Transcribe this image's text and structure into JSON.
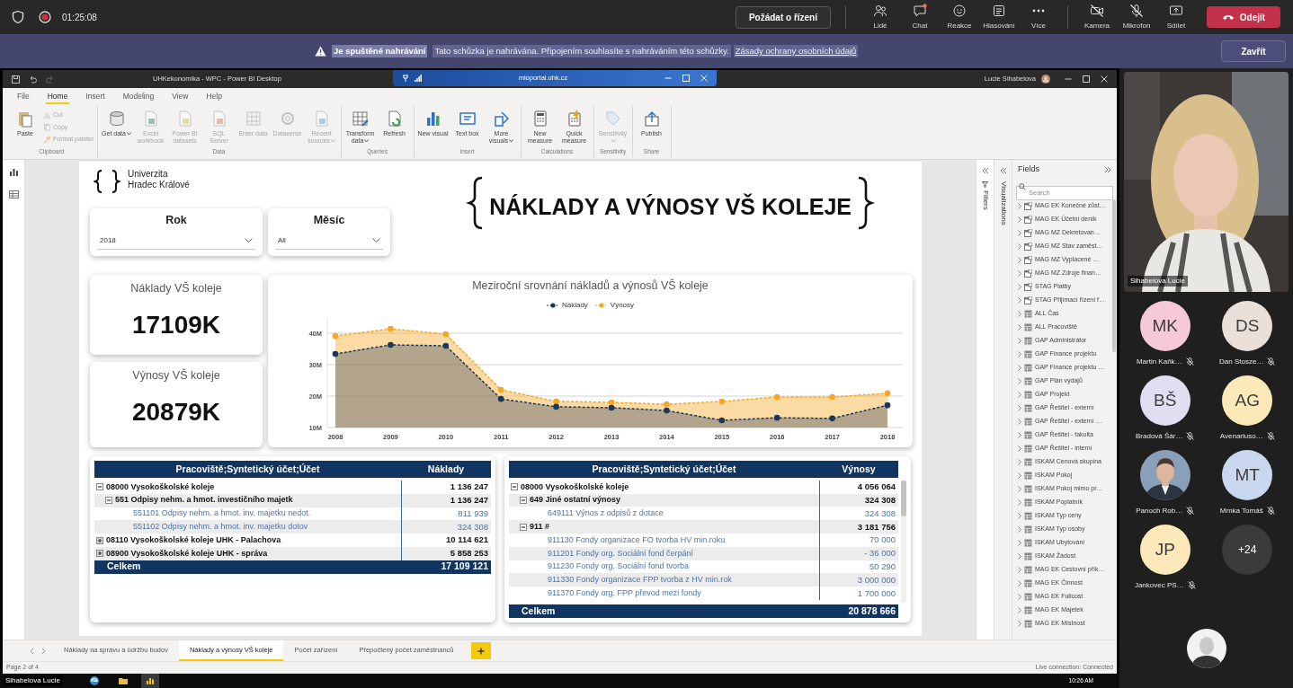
{
  "meeting_bar": {
    "timer": "01:25:08",
    "request_control": "Požádat o řízení",
    "tools": [
      {
        "kind": "people",
        "label": "Lidé",
        "badge": false
      },
      {
        "kind": "chat",
        "label": "Chat",
        "badge": true
      },
      {
        "kind": "reactions",
        "label": "Reakce",
        "badge": false
      },
      {
        "kind": "poll",
        "label": "Hlasování",
        "badge": false
      },
      {
        "kind": "more",
        "label": "Více",
        "badge": false
      }
    ],
    "devices": [
      {
        "kind": "camera",
        "label": "Kamera",
        "off": true
      },
      {
        "kind": "microphone",
        "label": "Mikrofon",
        "off": true
      },
      {
        "kind": "share",
        "label": "Sdílet",
        "off": false
      }
    ],
    "leave": "Odejít"
  },
  "recording_banner": {
    "title": "Je spuštěné nahrávání",
    "message": "Tato schůzka je nahrávána. Připojením souhlasíte s nahráváním této schůzky.",
    "link": "Zásady ochrany osobních údajů",
    "close": "Zavřít"
  },
  "window": {
    "title": "UHKekonomika - WPC - Power BI Desktop",
    "remote_host": "mioportal.uhk.cz",
    "user": "Lucie Sihabelova"
  },
  "ribbon": {
    "tabs": [
      {
        "label": "File",
        "selected": false
      },
      {
        "label": "Home",
        "selected": true
      },
      {
        "label": "Insert",
        "selected": false
      },
      {
        "label": "Modeling",
        "selected": false
      },
      {
        "label": "View",
        "selected": false
      },
      {
        "label": "Help",
        "selected": false
      }
    ],
    "groups": [
      {
        "name": "Clipboard",
        "buttons": [
          {
            "kind": "paste",
            "label": "Paste",
            "disabled": false,
            "dropdown": false
          }
        ],
        "small_buttons": [
          {
            "kind": "cut",
            "label": "Cut",
            "disabled": true,
            "dropdown": false
          },
          {
            "kind": "copy",
            "label": "Copy",
            "disabled": true,
            "dropdown": false
          },
          {
            "kind": "format_painter",
            "label": "Format painter",
            "disabled": true,
            "dropdown": false
          }
        ]
      },
      {
        "name": "Data",
        "buttons": [
          {
            "kind": "get_data",
            "label": "Get data",
            "disabled": false,
            "dropdown": true
          },
          {
            "kind": "excel",
            "label": "Excel workbook",
            "disabled": true,
            "dropdown": false
          },
          {
            "kind": "datasets",
            "label": "Power BI datasets",
            "disabled": true,
            "dropdown": false
          },
          {
            "kind": "sql",
            "label": "SQL Server",
            "disabled": true,
            "dropdown": false
          },
          {
            "kind": "enter_data",
            "label": "Enter data",
            "disabled": true,
            "dropdown": false
          },
          {
            "kind": "dataverse",
            "label": "Dataverse",
            "disabled": true,
            "dropdown": false
          },
          {
            "kind": "recent",
            "label": "Recent sources",
            "disabled": true,
            "dropdown": true
          }
        ]
      },
      {
        "name": "Queries",
        "buttons": [
          {
            "kind": "transform",
            "label": "Transform data",
            "disabled": false,
            "dropdown": true
          },
          {
            "kind": "refresh",
            "label": "Refresh",
            "disabled": false,
            "dropdown": false
          }
        ]
      },
      {
        "name": "Insert",
        "buttons": [
          {
            "kind": "new_visual",
            "label": "New visual",
            "disabled": false,
            "dropdown": false
          },
          {
            "kind": "text_box",
            "label": "Text box",
            "disabled": false,
            "dropdown": false
          },
          {
            "kind": "more_visuals",
            "label": "More visuals",
            "disabled": false,
            "dropdown": true
          }
        ]
      },
      {
        "name": "Calculations",
        "buttons": [
          {
            "kind": "new_measure",
            "label": "New measure",
            "disabled": false,
            "dropdown": false
          },
          {
            "kind": "quick_measure",
            "label": "Quick measure",
            "disabled": false,
            "dropdown": false
          }
        ]
      },
      {
        "name": "Sensitivity",
        "buttons": [
          {
            "kind": "sensitivity",
            "label": "Sensitivity",
            "disabled": true,
            "dropdown": true
          }
        ]
      },
      {
        "name": "Share",
        "buttons": [
          {
            "kind": "publish",
            "label": "Publish",
            "disabled": false,
            "dropdown": false
          }
        ]
      }
    ]
  },
  "report": {
    "logo_text": "Univerzita Hradec Králové",
    "title": "NÁKLADY A VÝNOSY VŠ KOLEJE",
    "slicers": [
      {
        "title": "Rok",
        "value": "2018"
      },
      {
        "title": "Měsíc",
        "value": "All"
      }
    ],
    "cards": [
      {
        "label": "Náklady VŠ koleje",
        "value": "17109K"
      },
      {
        "label": "Výnosy VŠ koleje",
        "value": "20879K"
      }
    ],
    "chart": {
      "chart_data": {
        "type": "area",
        "title": "Meziroční srovnání nákladů a výnosů VŠ koleje",
        "categories": [
          "2008",
          "2009",
          "2010",
          "2011",
          "2012",
          "2013",
          "2014",
          "2015",
          "2016",
          "2017",
          "2018"
        ],
        "series": [
          {
            "name": "Náklady",
            "color": "#1b365d",
            "values": [
              33.4,
              36.3,
              36.0,
              19.1,
              16.6,
              16.3,
              15.4,
              12.3,
              13.1,
              12.9,
              17.1
            ]
          },
          {
            "name": "Výnosy",
            "color": "#f5a623",
            "values": [
              39.1,
              41.4,
              39.7,
              22.0,
              18.3,
              18.0,
              17.4,
              18.3,
              19.7,
              19.7,
              20.9
            ]
          }
        ],
        "yticks": [
          {
            "value": 10,
            "label": "10M"
          },
          {
            "value": 20,
            "label": "20M"
          },
          {
            "value": 30,
            "label": "30M"
          },
          {
            "value": 40,
            "label": "40M"
          }
        ],
        "ylim": [
          10,
          45
        ],
        "grid": true,
        "legend": true
      }
    },
    "tables": [
      {
        "columns": [
          "Pracoviště;Syntetický účet;Účet",
          "Náklady"
        ],
        "rows": [
          {
            "label": "08000 Vysokoškolské koleje",
            "value": "1 136 247",
            "expanded": true,
            "children": [
              {
                "label": "551 Odpisy nehm. a hmot. investičního majetk",
                "value": "1 136 247",
                "expanded": true,
                "children": [
                  {
                    "label": "551101 Odpisy nehm. a hmot. inv. majetku nedot.",
                    "value": "811 939"
                  },
                  {
                    "label": "551102 Odpisy nehm. a hmot. inv. majetku dotov",
                    "value": "324 308"
                  }
                ]
              }
            ]
          },
          {
            "label": "08110 Vysokoškolské koleje UHK - Palachova",
            "value": "10 114 621",
            "expanded": false
          },
          {
            "label": "08900 Vysokoškolské koleje UHK - správa",
            "value": "5 858 253",
            "expanded": false
          }
        ],
        "total": {
          "label": "Celkem",
          "value": "17 109 121"
        }
      },
      {
        "columns": [
          "Pracoviště;Syntetický účet;Účet",
          "Výnosy"
        ],
        "rows": [
          {
            "label": "08000 Vysokoškolské koleje",
            "value": "4 056 064",
            "expanded": true,
            "children": [
              {
                "label": "649 Jiné ostatní výnosy",
                "value": "324 308",
                "expanded": true,
                "children": [
                  {
                    "label": "649111 Výnos z odpisů z dotace",
                    "value": "324 308"
                  }
                ]
              },
              {
                "label": "911 #",
                "value": "3 181 756",
                "expanded": true,
                "children": [
                  {
                    "label": "911130 Fondy organizace FO tvorba HV min.roku",
                    "value": "70 000"
                  },
                  {
                    "label": "911201 Fondy org. Sociální fond čerpání",
                    "value": "- 36 000"
                  },
                  {
                    "label": "911230 Fondy org. Sociální fond tvorba",
                    "value": "50 290"
                  },
                  {
                    "label": "911330 Fondy organizace FPP tvorba z HV min.rok",
                    "value": "3 000 000"
                  },
                  {
                    "label": "911370 Fondy org. FPP převod mezi fondy",
                    "value": "1 700 000"
                  }
                ]
              }
            ]
          }
        ],
        "total": {
          "label": "Celkem",
          "value": "20 878 666"
        }
      }
    ]
  },
  "side_panes": {
    "filters": "Filters",
    "visualizations": "Visualizations"
  },
  "fields_pane": {
    "title": "Fields",
    "search": {
      "placeholder": "Search"
    },
    "items": [
      {
        "label": "MAG EK Konečné zůst…",
        "kind": "calculated"
      },
      {
        "label": "MAG EK Účetní deník",
        "kind": "calculated"
      },
      {
        "label": "MAG MZ Dekretovan…",
        "kind": "calculated"
      },
      {
        "label": "MAG MZ Stav zaměst…",
        "kind": "calculated"
      },
      {
        "label": "MAG MZ Vyplacené …",
        "kind": "calculated"
      },
      {
        "label": "MAG MZ Zdroje finan…",
        "kind": "calculated"
      },
      {
        "label": "STAG Platby",
        "kind": "calculated"
      },
      {
        "label": "STAG Přijímací řízení f…",
        "kind": "calculated"
      },
      {
        "label": "ALL Čas",
        "kind": "table"
      },
      {
        "label": "ALL Pracoviště",
        "kind": "table"
      },
      {
        "label": "GAP Administrátor",
        "kind": "table"
      },
      {
        "label": "GAP Finance projektu",
        "kind": "table"
      },
      {
        "label": "GAP Finance projektu …",
        "kind": "table"
      },
      {
        "label": "GAP Plán výdajů",
        "kind": "table"
      },
      {
        "label": "GAP Projekt",
        "kind": "table"
      },
      {
        "label": "GAP Řešitel - externí",
        "kind": "table"
      },
      {
        "label": "GAP Řešitel - externí …",
        "kind": "table"
      },
      {
        "label": "GAP Řešitel - fakulta",
        "kind": "table"
      },
      {
        "label": "GAP Řešitel - interní",
        "kind": "table"
      },
      {
        "label": "ISKAM Cenová skupina",
        "kind": "table"
      },
      {
        "label": "ISKAM Pokoj",
        "kind": "table"
      },
      {
        "label": "ISKAM Pokoj mimo pr…",
        "kind": "table"
      },
      {
        "label": "ISKAM Poplatník",
        "kind": "table"
      },
      {
        "label": "ISKAM Typ ceny",
        "kind": "table"
      },
      {
        "label": "ISKAM Typ osoby",
        "kind": "table"
      },
      {
        "label": "ISKAM Ubytování",
        "kind": "table"
      },
      {
        "label": "ISKAM Žádost",
        "kind": "table"
      },
      {
        "label": "MAG EK Cestovní přík…",
        "kind": "table"
      },
      {
        "label": "MAG EK Činnost",
        "kind": "table"
      },
      {
        "label": "MAG EK Fullcost",
        "kind": "table"
      },
      {
        "label": "MAG EK Majetek",
        "kind": "table"
      },
      {
        "label": "MAG EK Místnost",
        "kind": "table"
      }
    ]
  },
  "page_tabs": [
    {
      "label": "Náklady na správu a údržbu budov",
      "selected": false
    },
    {
      "label": "Náklady a výnosy VŠ koleje",
      "selected": true
    },
    {
      "label": "Počet zařízení",
      "selected": false
    },
    {
      "label": "Přepočtený počet zaměstnanců",
      "selected": false
    }
  ],
  "status_bar": {
    "page": "Page 2 of 4",
    "connection": "Live connection: Connected"
  },
  "taskbar": {
    "user": "Sihabelova Lucie",
    "time": "10:26 AM"
  },
  "participants": {
    "video": {
      "name": "Sihabelova Lucie"
    },
    "people": [
      {
        "kind": "initials",
        "initials": "MK",
        "name": "Martin Kaňk…",
        "color": "#f5c9d9",
        "muted": true
      },
      {
        "kind": "initials",
        "initials": "DS",
        "name": "Dan Stosze…",
        "color": "#ebe0d8",
        "muted": true
      },
      {
        "kind": "initials",
        "initials": "BŠ",
        "name": "Bradová Šár…",
        "color": "#e2def2",
        "muted": true
      },
      {
        "kind": "initials",
        "initials": "AG",
        "name": "Avenariuso…",
        "color": "#fbe9b9",
        "muted": true
      },
      {
        "name": "Panoch Rob…",
        "muted": true
      },
      {
        "kind": "initials",
        "initials": "MT",
        "name": "Mrnka Tomáš",
        "color": "#cad8ef",
        "muted": true
      },
      {
        "kind": "initials",
        "initials": "JP",
        "name": "Jankovec PS…",
        "color": "#fbe9b9",
        "muted": true
      },
      {
        "kind": "overflow",
        "count": "+24"
      }
    ]
  }
}
